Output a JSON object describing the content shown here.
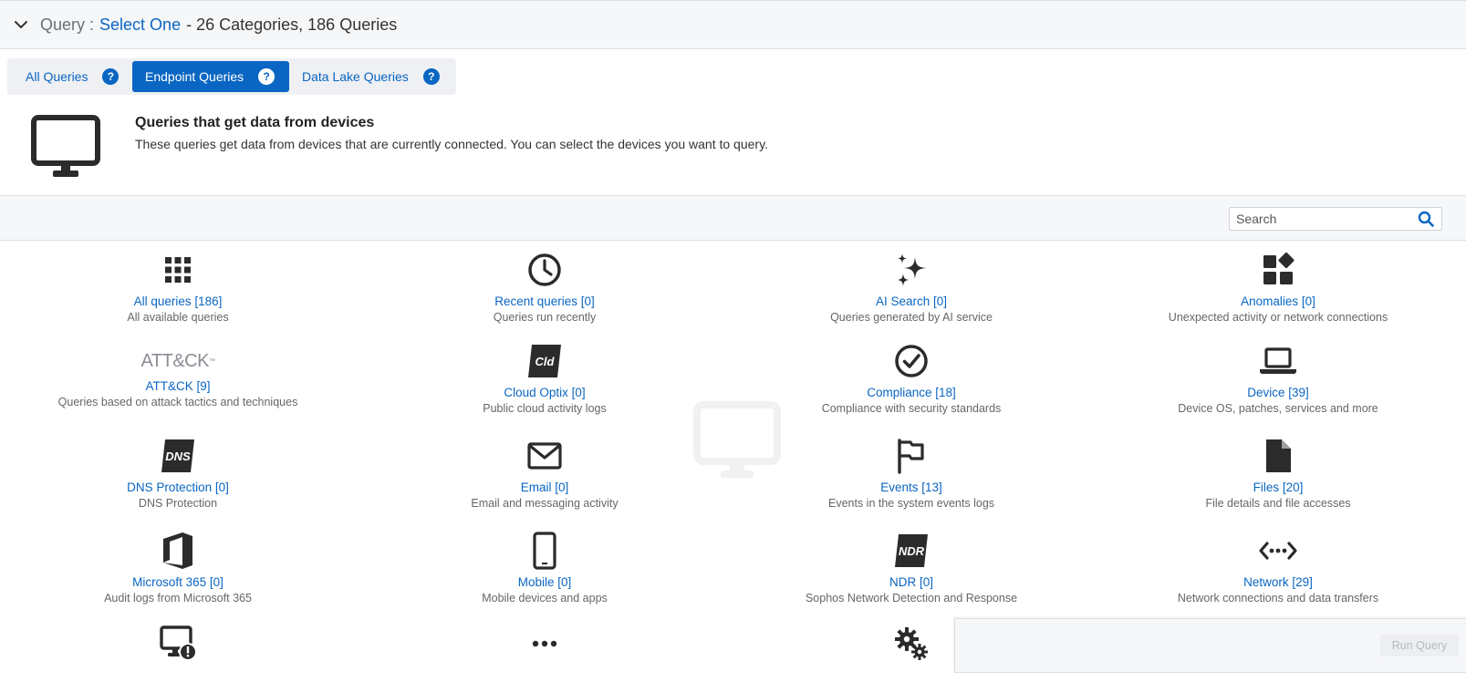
{
  "header": {
    "label": "Query :",
    "selection": "Select One",
    "summary": "- 26 Categories, 186 Queries"
  },
  "tabs": [
    {
      "label": "All Queries",
      "active": false
    },
    {
      "label": "Endpoint Queries",
      "active": true
    },
    {
      "label": "Data Lake Queries",
      "active": false
    }
  ],
  "intro": {
    "title": "Queries that get data from devices",
    "description": "These queries get data from devices that are currently connected. You can select the devices you want to query."
  },
  "search": {
    "placeholder": "Search"
  },
  "categories": [
    {
      "icon": "grid-icon",
      "name": "All queries [186]",
      "desc": "All available queries"
    },
    {
      "icon": "clock-icon",
      "name": "Recent queries [0]",
      "desc": "Queries run recently"
    },
    {
      "icon": "sparkle-icon",
      "name": "AI Search [0]",
      "desc": "Queries generated by AI service"
    },
    {
      "icon": "shapes-icon",
      "name": "Anomalies [0]",
      "desc": "Unexpected activity or network connections"
    },
    {
      "icon": "attck-logo",
      "logo_text": "ATT&CK",
      "name": "ATT&CK [9]",
      "desc": "Queries based on attack tactics and techniques"
    },
    {
      "icon": "cloud-optix-icon",
      "logo_text": "Cld",
      "name": "Cloud Optix [0]",
      "desc": "Public cloud activity logs"
    },
    {
      "icon": "check-circle-icon",
      "name": "Compliance [18]",
      "desc": "Compliance with security standards"
    },
    {
      "icon": "laptop-icon",
      "name": "Device [39]",
      "desc": "Device OS, patches, services and more"
    },
    {
      "icon": "dns-icon",
      "logo_text": "DNS",
      "name": "DNS Protection [0]",
      "desc": "DNS Protection"
    },
    {
      "icon": "envelope-icon",
      "name": "Email [0]",
      "desc": "Email and messaging activity"
    },
    {
      "icon": "flag-icon",
      "name": "Events [13]",
      "desc": "Events in the system events logs"
    },
    {
      "icon": "file-icon",
      "name": "Files [20]",
      "desc": "File details and file accesses"
    },
    {
      "icon": "office-icon",
      "name": "Microsoft 365 [0]",
      "desc": "Audit logs from Microsoft 365"
    },
    {
      "icon": "mobile-icon",
      "name": "Mobile [0]",
      "desc": "Mobile devices and apps"
    },
    {
      "icon": "ndr-icon",
      "logo_text": "NDR",
      "name": "NDR [0]",
      "desc": "Sophos Network Detection and Response"
    },
    {
      "icon": "network-icon",
      "name": "Network [29]",
      "desc": "Network connections and data transfers"
    },
    {
      "icon": "monitor-alert-icon",
      "name": "",
      "desc": ""
    },
    {
      "icon": "more-icon",
      "name": "",
      "desc": ""
    },
    {
      "icon": "gears-icon",
      "name": "",
      "desc": ""
    }
  ],
  "run_button": {
    "label": "Run Query",
    "enabled": false
  },
  "colors": {
    "accent": "#0a66c2",
    "icon": "#2b2b2b",
    "muted": "#666666"
  }
}
